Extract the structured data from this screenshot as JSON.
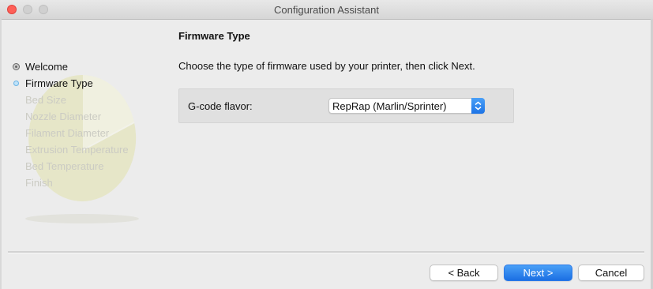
{
  "window": {
    "title": "Configuration Assistant"
  },
  "steps": [
    {
      "label": "Welcome",
      "state": "past"
    },
    {
      "label": "Firmware Type",
      "state": "current"
    },
    {
      "label": "Bed Size",
      "state": "future"
    },
    {
      "label": "Nozzle Diameter",
      "state": "future"
    },
    {
      "label": "Filament Diameter",
      "state": "future"
    },
    {
      "label": "Extrusion Temperature",
      "state": "future"
    },
    {
      "label": "Bed Temperature",
      "state": "future"
    },
    {
      "label": "Finish",
      "state": "future"
    }
  ],
  "page": {
    "title": "Firmware Type",
    "instruction": "Choose the type of firmware used by your printer, then click Next.",
    "gcode_flavor": {
      "label": "G-code flavor:",
      "selected": "RepRap (Marlin/Sprinter)"
    }
  },
  "buttons": {
    "back": "< Back",
    "next": "Next >",
    "cancel": "Cancel"
  },
  "colors": {
    "accent": "#1c73e6",
    "close": "#fe5f57"
  }
}
